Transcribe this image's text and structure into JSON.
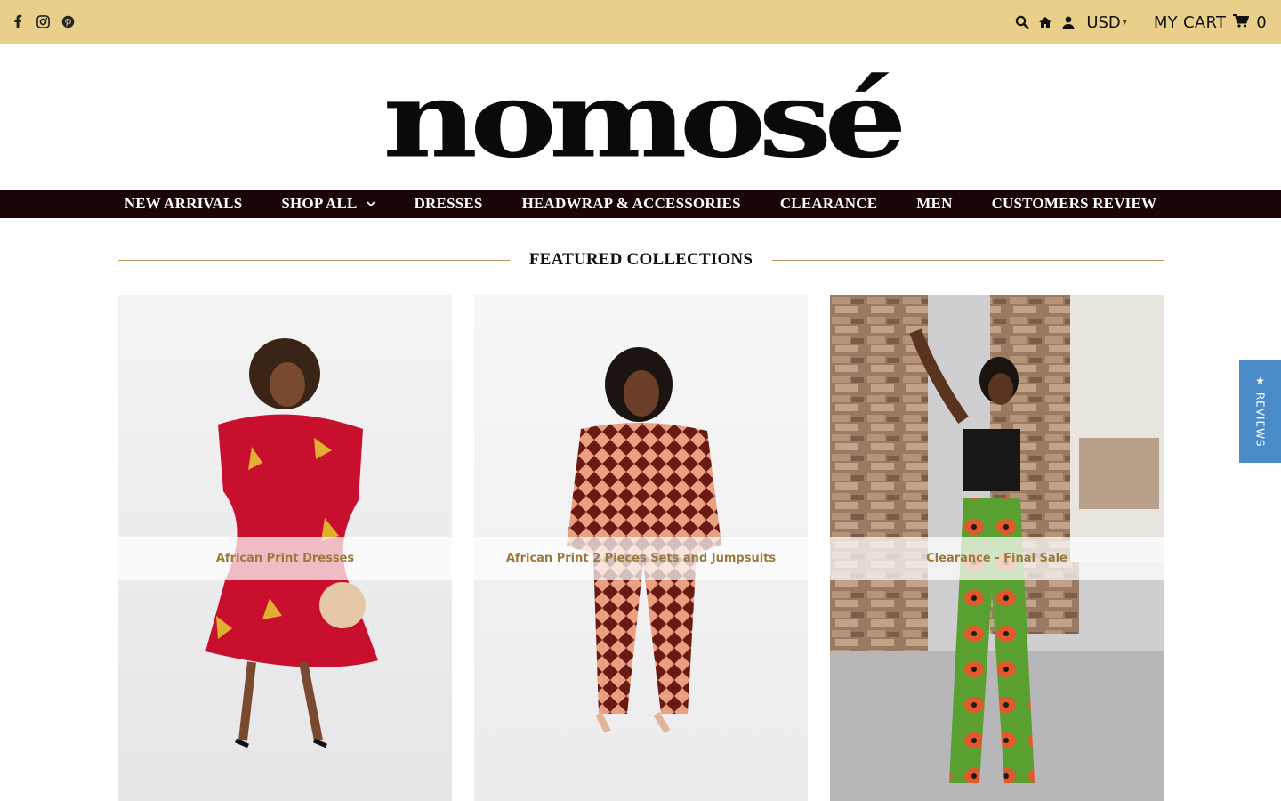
{
  "topbar": {
    "social_icons": [
      "facebook-icon",
      "instagram-icon",
      "pinterest-icon"
    ],
    "right_icons": [
      "search-icon",
      "home-icon",
      "user-icon"
    ],
    "currency": "USD",
    "cart_label": "MY CART",
    "cart_count": "0",
    "background": "#e9cf8a"
  },
  "brand": {
    "logo_text": "nomosé"
  },
  "nav": {
    "items": [
      {
        "label": "NEW ARRIVALS"
      },
      {
        "label": "SHOP ALL",
        "has_dropdown": true
      },
      {
        "label": "DRESSES"
      },
      {
        "label": "HEADWRAP & ACCESSORIES"
      },
      {
        "label": "CLEARANCE"
      },
      {
        "label": "MEN"
      },
      {
        "label": "CUSTOMERS REVIEW"
      }
    ],
    "background": "#1a0606"
  },
  "featured": {
    "title": "FEATURED COLLECTIONS",
    "collections": [
      {
        "label": "African Print Dresses"
      },
      {
        "label": "African Print 2 Pieces Sets and Jumpsuits"
      },
      {
        "label": "Clearance - Final Sale"
      }
    ]
  },
  "reviews_tab": {
    "label": "★ REVIEWS",
    "color": "#4a8cc8"
  }
}
